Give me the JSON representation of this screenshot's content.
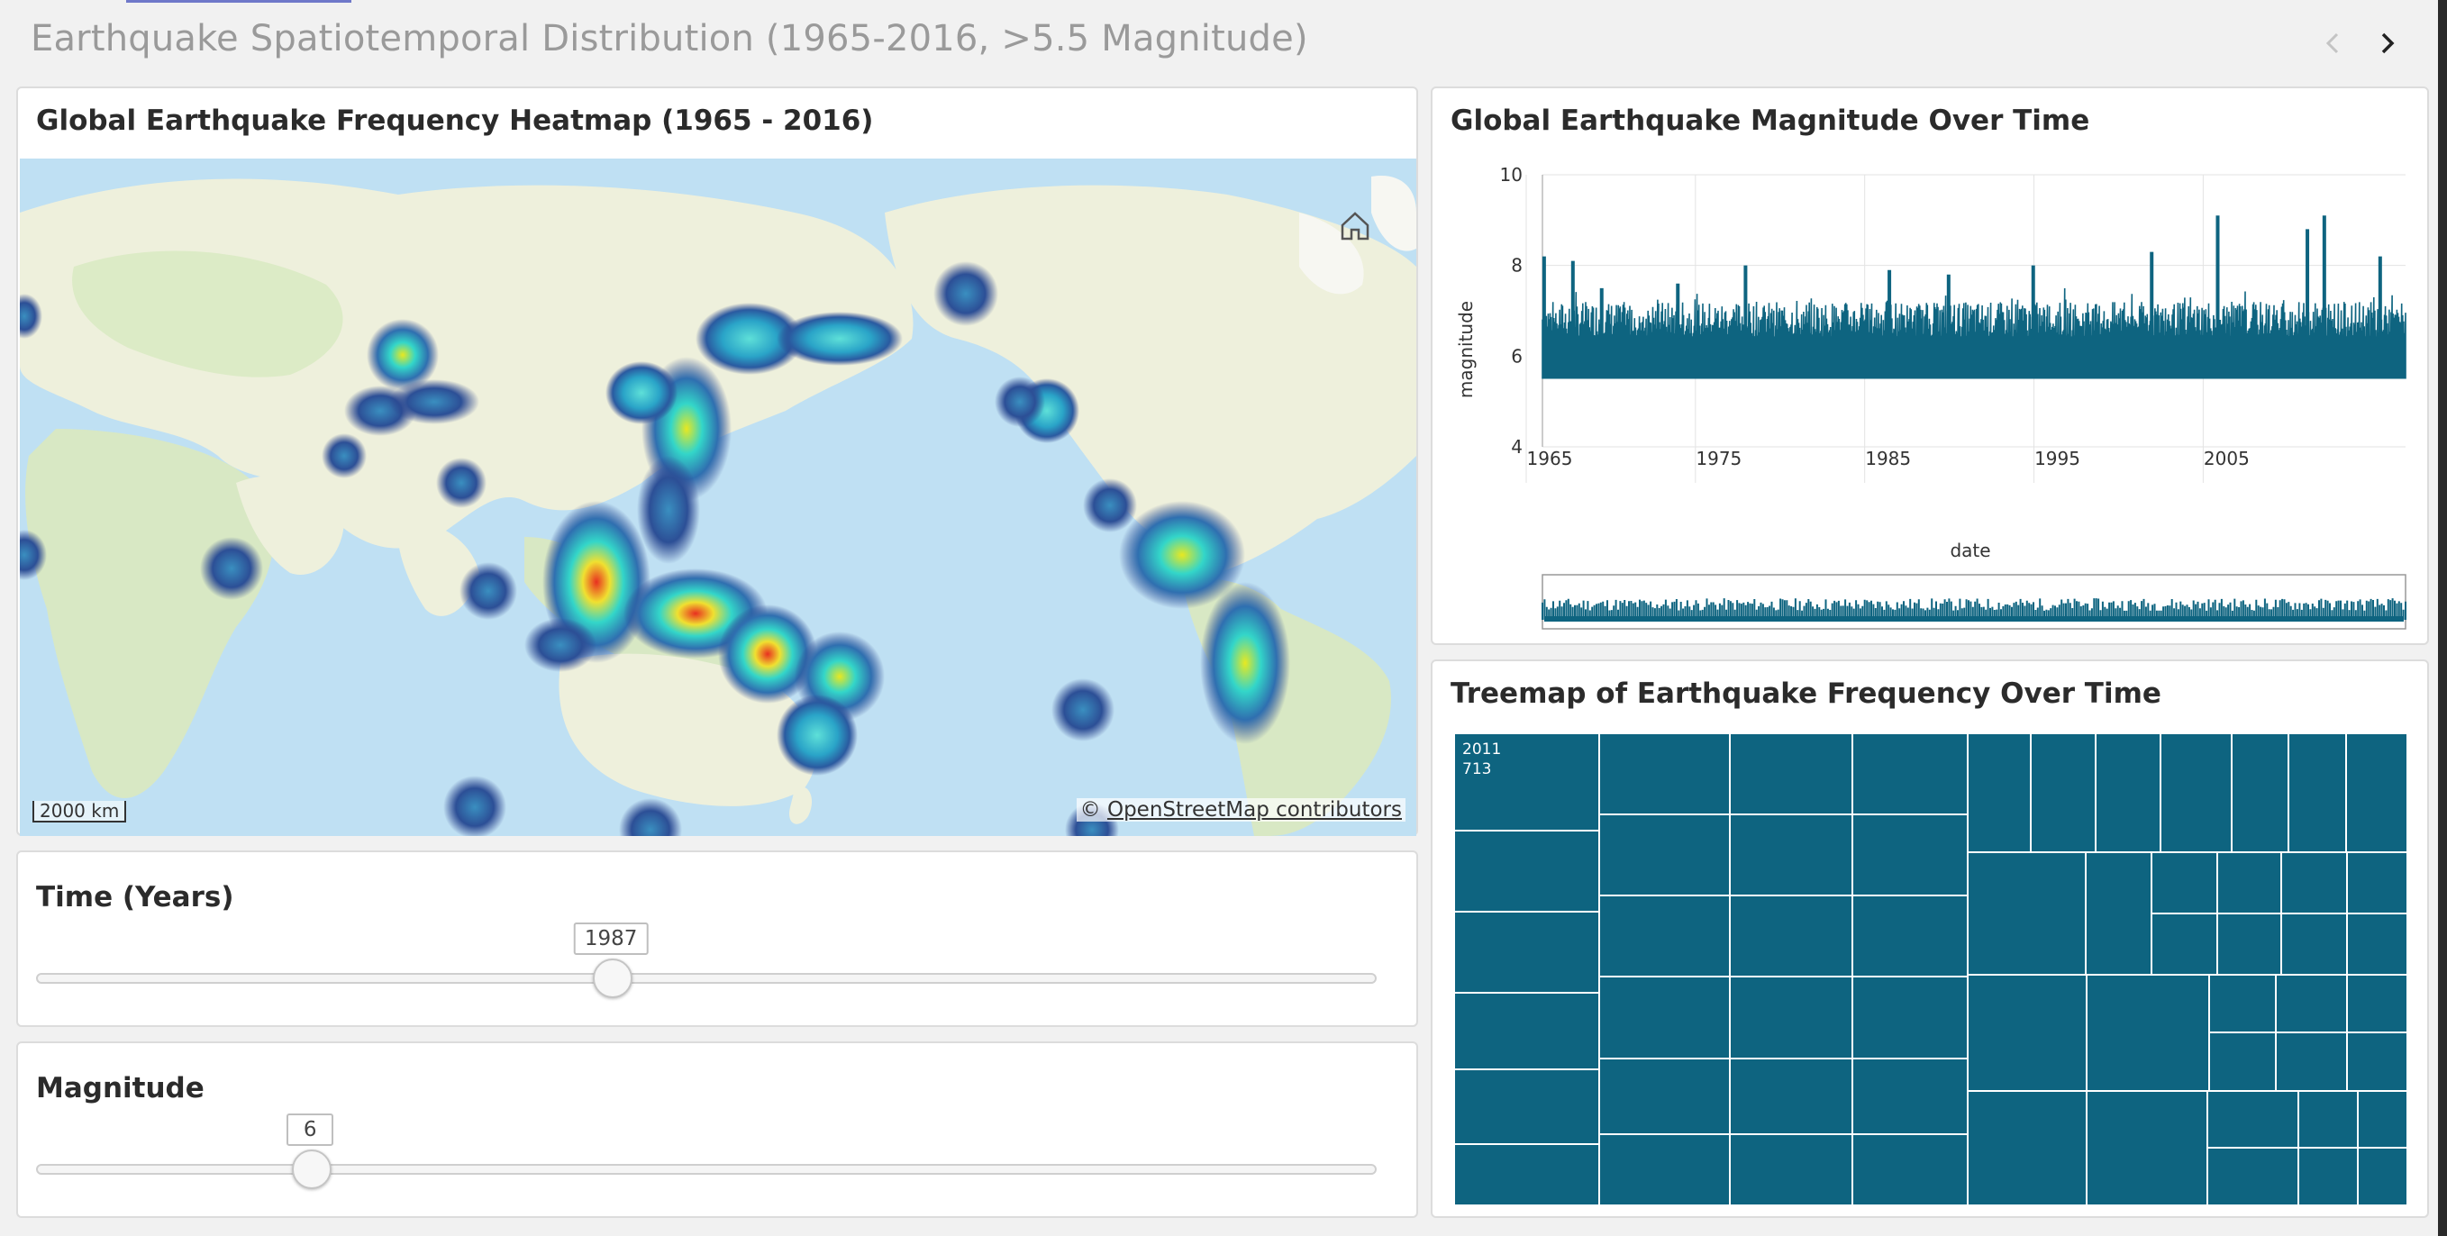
{
  "page": {
    "title": "Earthquake Spatiotemporal Distribution (1965-2016, >5.5 Magnitude)"
  },
  "nav": {
    "prev_icon": "chevron-left-icon",
    "next_icon": "chevron-right-icon"
  },
  "map": {
    "title": "Global Earthquake Frequency Heatmap (1965 - 2016)",
    "scale_label": "2000 km",
    "attribution_symbol": "©",
    "attribution_link": "OpenStreetMap contributors",
    "home_icon": "home-icon",
    "colors": {
      "ocean": "#bfe0f3",
      "land": "#eef0dc",
      "land_green": "#d8e8c4"
    }
  },
  "time_filter": {
    "title": "Time (Years)",
    "value": "1987",
    "level": 0.43
  },
  "magnitude_filter": {
    "title": "Magnitude",
    "value": "6",
    "level": 0.205
  },
  "line_chart": {
    "title": "Global Earthquake Magnitude Over Time",
    "ylabel": "magnitude",
    "xlabel": "date",
    "y_ticks": [
      "10",
      "8",
      "6",
      "4"
    ],
    "x_ticks": [
      "1965",
      "1975",
      "1985",
      "1995",
      "2005"
    ],
    "color": "#0e6480"
  },
  "treemap": {
    "title": "Treemap of Earthquake Frequency Over Time",
    "first_label_year": "2011",
    "first_label_count": "713",
    "color": "#0e6480"
  },
  "chart_data": [
    {
      "type": "line",
      "title": "Global Earthquake Magnitude Over Time",
      "xlabel": "date",
      "ylabel": "magnitude",
      "xlim": [
        1965,
        2016
      ],
      "ylim": [
        4,
        10
      ],
      "x_ticks": [
        1965,
        1975,
        1985,
        1995,
        2005
      ],
      "y_ticks": [
        4,
        6,
        8,
        10
      ],
      "baseline": 5.5,
      "typical_peak": 7.2,
      "peaks": [
        {
          "x": 1965.1,
          "y": 8.2
        },
        {
          "x": 1966.8,
          "y": 8.1
        },
        {
          "x": 1968.5,
          "y": 7.5
        },
        {
          "x": 1973.0,
          "y": 7.6
        },
        {
          "x": 1977.0,
          "y": 8.0
        },
        {
          "x": 1985.5,
          "y": 7.9
        },
        {
          "x": 1989.0,
          "y": 7.8
        },
        {
          "x": 1994.0,
          "y": 8.0
        },
        {
          "x": 2001.0,
          "y": 8.3
        },
        {
          "x": 2004.9,
          "y": 9.1
        },
        {
          "x": 2010.2,
          "y": 8.8
        },
        {
          "x": 2011.2,
          "y": 9.1
        },
        {
          "x": 2014.5,
          "y": 8.2
        }
      ]
    },
    {
      "type": "heatmap",
      "title": "Treemap of Earthquake Frequency Over Time",
      "labels": [
        {
          "year": "2011",
          "count": 713
        }
      ]
    }
  ]
}
